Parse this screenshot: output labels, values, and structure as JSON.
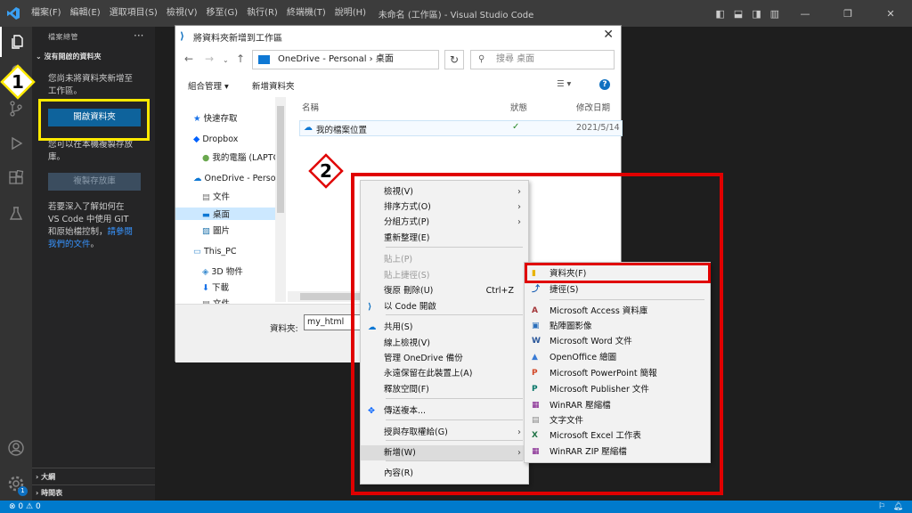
{
  "titlebar": {
    "menus": [
      "檔案(F)",
      "編輯(E)",
      "選取項目(S)",
      "檢視(V)",
      "移至(G)",
      "執行(R)",
      "終端機(T)",
      "說明(H)"
    ],
    "window_title": "未命名 (工作區) - Visual Studio Code"
  },
  "sidebar": {
    "title": "檔案總管",
    "section": "沒有開啟的資料夾",
    "no_folder_line1": "您尚未將資料夾新增至",
    "no_folder_line2": "工作區。",
    "open_folder_button": "開啟資料夾",
    "clone_line1": "您可以在本機複製存放",
    "clone_line2": "庫。",
    "clone_button": "複製存放庫",
    "learn_line1": "若要深入了解如何在",
    "learn_line2": "VS Code 中使用 GIT",
    "learn_line3a": "和原始檔控制，",
    "learn_link1": "請參閱",
    "learn_link2": "我們的文件",
    "learn_end": "。",
    "outline": "大綱",
    "timeline": "時間表"
  },
  "statusbar": {
    "errors": "0",
    "warnings": "0"
  },
  "annotations": {
    "step1": "1",
    "step2": "2"
  },
  "dialog": {
    "title": "將資料夾新增到工作區",
    "address": "OneDrive - Personal  ›  桌面",
    "search_placeholder": "搜尋 桌面",
    "organize": "組合管理 ▾",
    "new_folder": "新增資料夾",
    "nav": [
      "快速存取",
      "Dropbox",
      "我的電腦 (LAPTO",
      "OneDrive - Perso",
      "文件",
      "桌面",
      "圖片",
      "This_PC",
      "3D 物件",
      "下載",
      "文件"
    ],
    "columns": {
      "name": "名稱",
      "status": "狀態",
      "modified": "修改日期"
    },
    "file": {
      "name": "我的檔案位置",
      "date": "2021/5/14"
    },
    "folder_label": "資料夾:",
    "folder_value": "my_html"
  },
  "context_menu": {
    "items": [
      {
        "label": "檢視(V)",
        "arrow": true
      },
      {
        "label": "排序方式(O)",
        "arrow": true
      },
      {
        "label": "分組方式(P)",
        "arrow": true
      },
      {
        "label": "重新整理(E)"
      },
      {
        "label": "貼上(P)",
        "disabled": true
      },
      {
        "label": "貼上捷徑(S)",
        "disabled": true
      },
      {
        "label": "復原 刪除(U)",
        "shortcut": "Ctrl+Z"
      },
      {
        "label": "以 Code 開啟"
      },
      {
        "label": "共用(S)"
      },
      {
        "label": "線上檢視(V)"
      },
      {
        "label": "管理 OneDrive 備份"
      },
      {
        "label": "永遠保留在此裝置上(A)"
      },
      {
        "label": "釋放空間(F)"
      },
      {
        "label": "傳送複本..."
      },
      {
        "label": "授與存取權給(G)",
        "arrow": true
      },
      {
        "label": "新增(W)",
        "arrow": true
      },
      {
        "label": "內容(R)"
      }
    ]
  },
  "submenu": {
    "items": [
      "資料夾(F)",
      "捷徑(S)",
      "Microsoft Access 資料庫",
      "點陣圖影像",
      "Microsoft Word 文件",
      "OpenOffice 繪圖",
      "Microsoft PowerPoint 簡報",
      "Microsoft Publisher 文件",
      "WinRAR 壓縮檔",
      "文字文件",
      "Microsoft Excel 工作表",
      "WinRAR ZIP 壓縮檔"
    ]
  }
}
